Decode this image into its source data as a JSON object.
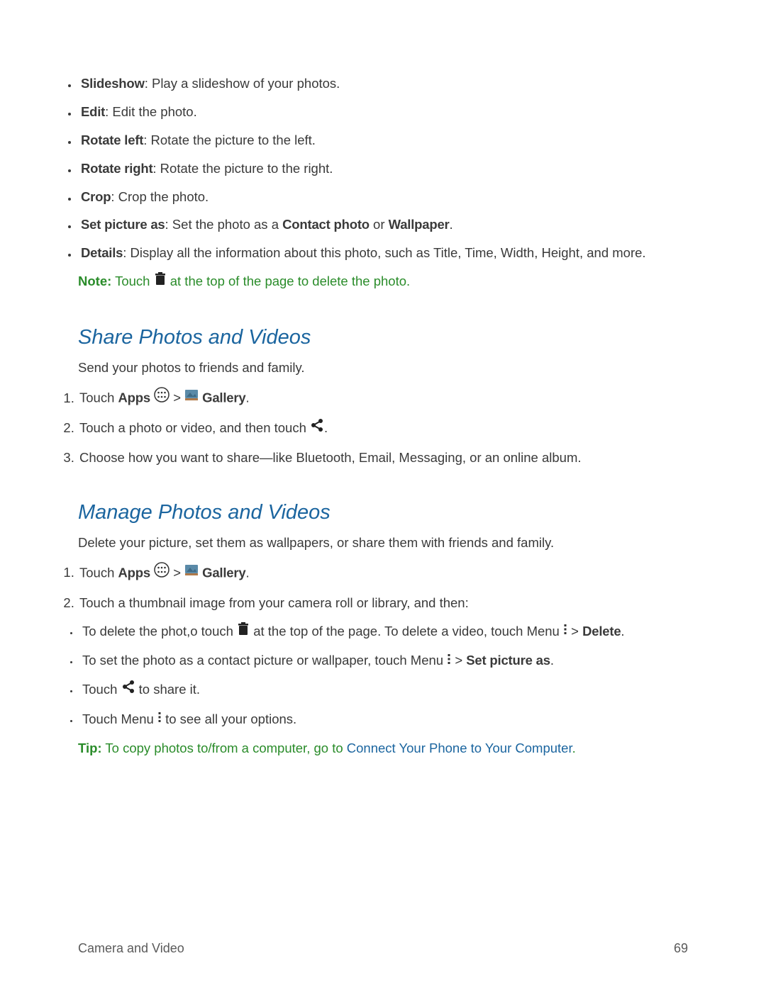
{
  "top_bullets": [
    {
      "label": "Slideshow",
      "text": ": Play a slideshow of your photos."
    },
    {
      "label": "Edit",
      "text": ": Edit the photo."
    },
    {
      "label": "Rotate left",
      "text": ": Rotate the picture to the left."
    },
    {
      "label": "Rotate right",
      "text": ": Rotate the picture to the right."
    },
    {
      "label": "Crop",
      "text": ": Crop the photo."
    }
  ],
  "set_picture": {
    "label": "Set picture as",
    "pre": ": Set the photo as a ",
    "cp": "Contact photo",
    "or": " or ",
    "wp": "Wallpaper",
    "end": "."
  },
  "details": {
    "label": "Details",
    "text": ": Display all the information about this photo, such as Title, Time, Width, Height, and more."
  },
  "note": {
    "label": "Note:",
    "pre": "  Touch ",
    "post": " at the top of the page to delete the photo."
  },
  "share": {
    "heading": "Share Photos and Videos",
    "intro": "Send your photos to friends and family.",
    "step1": {
      "pre": "Touch ",
      "apps": "Apps",
      "mid": " > ",
      "gal": " Gallery",
      "end": "."
    },
    "step2": {
      "pre": "Touch a photo or video, and then touch ",
      "end": "."
    },
    "step3": "Choose how you want to share—like Bluetooth, Email, Messaging, or an online album."
  },
  "manage": {
    "heading": "Manage Photos and Videos",
    "intro": "Delete your picture, set them as wallpapers, or share them with friends and family.",
    "step1": {
      "pre": "Touch ",
      "apps": "Apps",
      "mid": " > ",
      "gal": " Gallery",
      "end": "."
    },
    "step2": "Touch a thumbnail image from your camera roll or library, and then:",
    "sub1": {
      "a": "To delete the phot,o touch ",
      "b": " at the top of the page. To delete a video, touch Menu ",
      "c": " > ",
      "d": "Delete",
      "e": "."
    },
    "sub2": {
      "a": "To set the photo as a contact picture or wallpaper, touch Menu ",
      "b": " > ",
      "c": "Set picture as",
      "d": "."
    },
    "sub3": {
      "a": "Touch ",
      "b": " to share it."
    },
    "sub4": {
      "a": "Touch Menu ",
      "b": " to see all your options."
    }
  },
  "tip": {
    "label": "Tip:",
    "pre": " To copy photos to/from a computer, go to ",
    "link": "Connect Your Phone to Your Computer",
    "end": "."
  },
  "footer": {
    "left": "Camera and Video",
    "right": "69"
  }
}
